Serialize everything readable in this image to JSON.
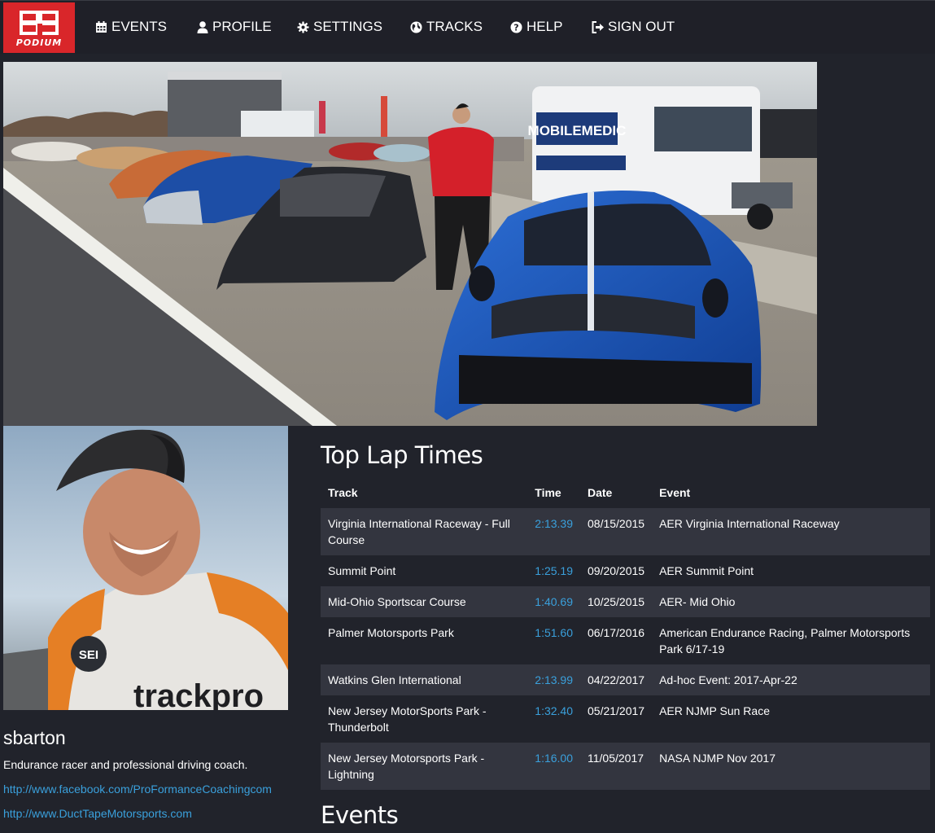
{
  "brand": {
    "logo_text": "PODIUM",
    "color": "#d9262a"
  },
  "nav": {
    "items": [
      {
        "label": "EVENTS",
        "icon": "calendar-icon"
      },
      {
        "label": "PROFILE",
        "icon": "user-icon"
      },
      {
        "label": "SETTINGS",
        "icon": "gear-icon"
      },
      {
        "label": "TRACKS",
        "icon": "globe-icon"
      },
      {
        "label": "HELP",
        "icon": "question-circle-icon"
      },
      {
        "label": "SIGN OUT",
        "icon": "sign-out-icon"
      }
    ]
  },
  "profile": {
    "username": "sbarton",
    "bio": "Endurance racer and professional driving coach.",
    "links": [
      "http://www.facebook.com/ProFormanceCoachingcom",
      "http://www.DuctTapeMotorsports.com"
    ]
  },
  "top_laps": {
    "title": "Top Lap Times",
    "columns": [
      "Track",
      "Time",
      "Date",
      "Event"
    ],
    "rows": [
      {
        "track": "Virginia International Raceway - Full Course",
        "time": "2:13.39",
        "date": "08/15/2015",
        "event": "AER Virginia International Raceway"
      },
      {
        "track": "Summit Point",
        "time": "1:25.19",
        "date": "09/20/2015",
        "event": "AER Summit Point"
      },
      {
        "track": "Mid-Ohio Sportscar Course",
        "time": "1:40.69",
        "date": "10/25/2015",
        "event": "AER- Mid Ohio"
      },
      {
        "track": "Palmer Motorsports Park",
        "time": "1:51.60",
        "date": "06/17/2016",
        "event": "American Endurance Racing, Palmer Motorsports Park 6/17-19"
      },
      {
        "track": "Watkins Glen International",
        "time": "2:13.99",
        "date": "04/22/2017",
        "event": "Ad-hoc Event: 2017-Apr-22"
      },
      {
        "track": "New Jersey MotorSports Park - Thunderbolt",
        "time": "1:32.40",
        "date": "05/21/2017",
        "event": "AER NJMP Sun Race"
      },
      {
        "track": "New Jersey Motorsports Park - Lightning",
        "time": "1:16.00",
        "date": "11/05/2017",
        "event": "NASA NJMP Nov 2017"
      }
    ]
  },
  "events": {
    "title": "Events"
  },
  "colors": {
    "background": "#21232b",
    "link": "#3aa0dc",
    "row_alt": "#33353f"
  }
}
